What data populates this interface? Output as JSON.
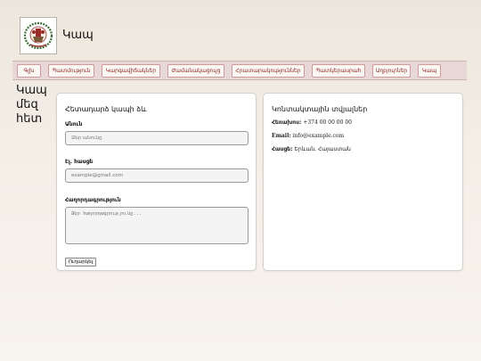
{
  "site": {
    "title": "Կապ"
  },
  "nav": {
    "items": [
      "Գլխ",
      "Պատմություն",
      "Կարգավիճակներ",
      "Ժամանակացույց",
      "Հրատարակություններ",
      "Պատկերասրահ",
      "Աղբյուրներ",
      "Կապ"
    ]
  },
  "page": {
    "heading_line1": "Կապ",
    "heading_line2": "մեզ",
    "heading_line3": "հետ"
  },
  "form": {
    "title": "Հետադարձ կապի ձև",
    "name_label": "Անուն",
    "name_placeholder": "Ձեր անունը",
    "email_label": "Էլ. հասցե",
    "email_placeholder": "example@gmail.com",
    "message_label": "Հաղորդագրություն",
    "message_placeholder": "Ձեր հաղորդագրությունը...",
    "submit_label": "Ուղարկել"
  },
  "contact": {
    "title": "Կոնտակտային տվյալներ",
    "phone_label": "Հեռախոս:",
    "phone_value": "+374 00 00 00 00",
    "email_label": "Email:",
    "email_value": "info@example.com",
    "address_label": "Հասցե:",
    "address_value": "Երևան, Հայաստան"
  },
  "colors": {
    "nav_text": "#8a1f1f",
    "nav_bar": "#e7d7d7",
    "logo_green": "#3f6b3a",
    "logo_red": "#9b2a2a"
  }
}
